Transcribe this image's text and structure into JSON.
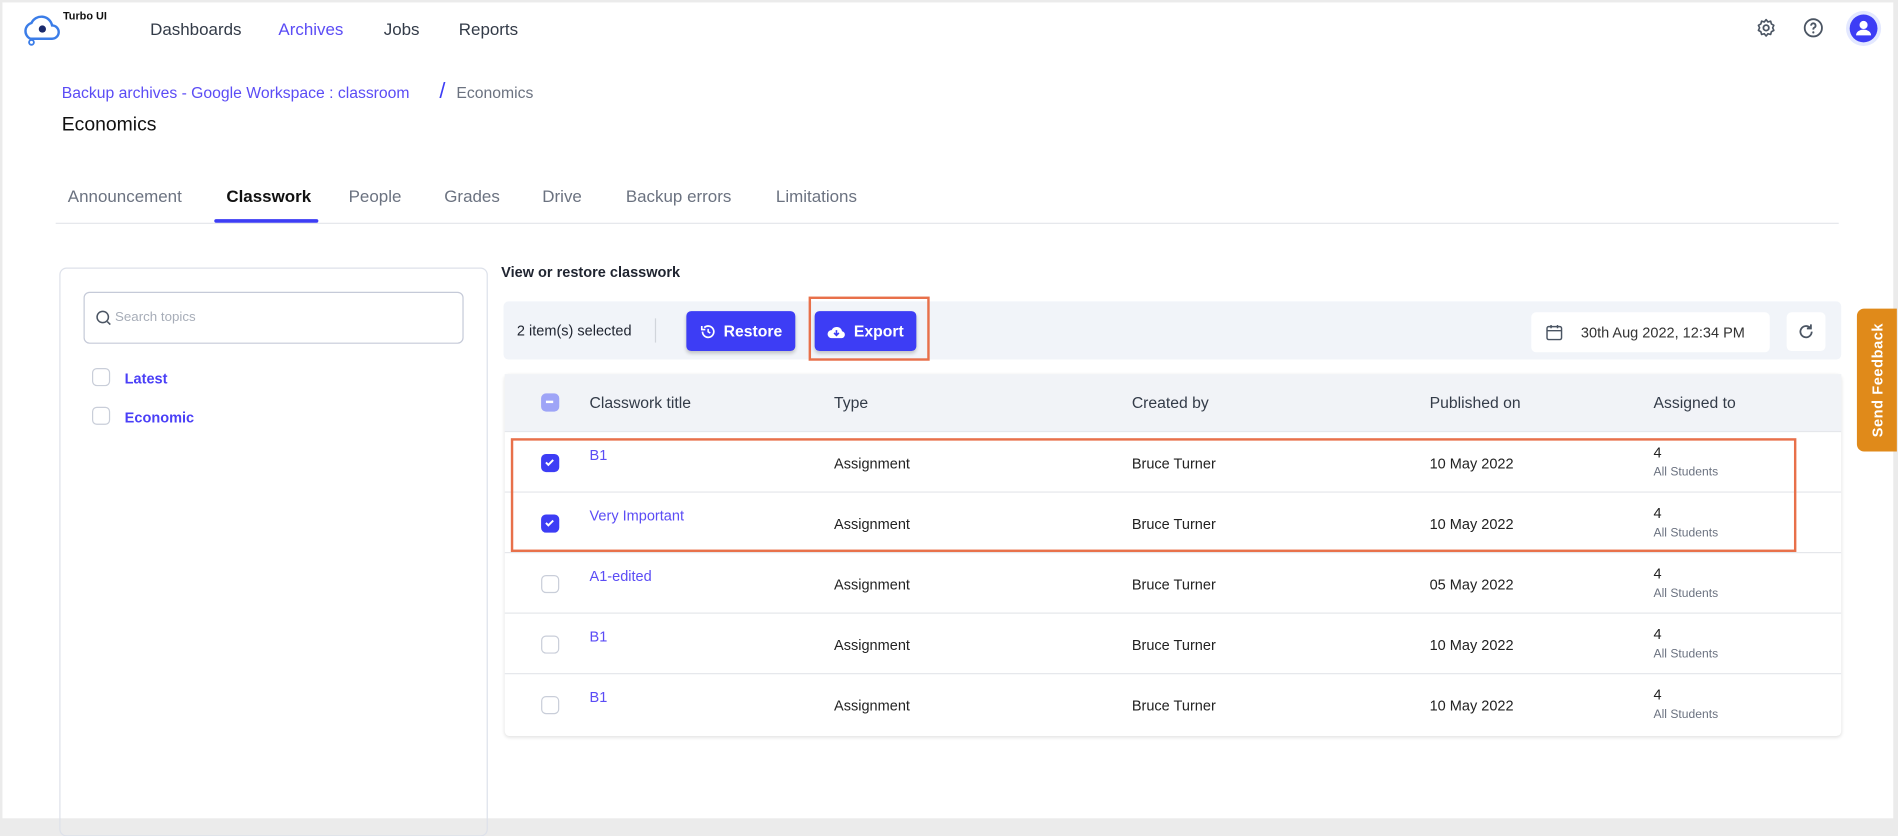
{
  "app": {
    "name": "Turbo UI"
  },
  "nav": {
    "items": [
      {
        "label": "Dashboards"
      },
      {
        "label": "Archives",
        "active": true
      },
      {
        "label": "Jobs"
      },
      {
        "label": "Reports"
      }
    ]
  },
  "breadcrumb": {
    "parent": "Backup archives - Google Workspace : classroom",
    "separator": "/",
    "current": "Economics"
  },
  "page_title": "Economics",
  "tabs": [
    "Announcement",
    "Classwork",
    "People",
    "Grades",
    "Drive",
    "Backup errors",
    "Limitations"
  ],
  "active_tab": "Classwork",
  "sidebar": {
    "search_placeholder": "Search topics",
    "topics": [
      "Latest",
      "Economic"
    ]
  },
  "section_title": "View or restore classwork",
  "toolbar": {
    "selected": "2 item(s) selected",
    "restore": "Restore",
    "export": "Export",
    "date": "30th Aug 2022, 12:34 PM"
  },
  "table": {
    "headers": [
      "Classwork title",
      "Type",
      "Created by",
      "Published on",
      "Assigned to"
    ],
    "rows": [
      {
        "checked": true,
        "title": "B1",
        "type": "Assignment",
        "created_by": "Bruce Turner",
        "published": "10 May 2022",
        "assigned_count": "4",
        "assigned_to": "All Students"
      },
      {
        "checked": true,
        "title": "Very Important",
        "type": "Assignment",
        "created_by": "Bruce Turner",
        "published": "10 May 2022",
        "assigned_count": "4",
        "assigned_to": "All Students"
      },
      {
        "checked": false,
        "title": "A1-edited",
        "type": "Assignment",
        "created_by": "Bruce Turner",
        "published": "05 May 2022",
        "assigned_count": "4",
        "assigned_to": "All Students"
      },
      {
        "checked": false,
        "title": "B1",
        "type": "Assignment",
        "created_by": "Bruce Turner",
        "published": "10 May 2022",
        "assigned_count": "4",
        "assigned_to": "All Students"
      },
      {
        "checked": false,
        "title": "B1",
        "type": "Assignment",
        "created_by": "Bruce Turner",
        "published": "10 May 2022",
        "assigned_count": "4",
        "assigned_to": "All Students"
      }
    ]
  },
  "feedback": "Send Feedback",
  "colors": {
    "accent": "#3d3df5",
    "link": "#5b4cf5",
    "highlight": "#e8704a",
    "feedback": "#e08a1a"
  }
}
